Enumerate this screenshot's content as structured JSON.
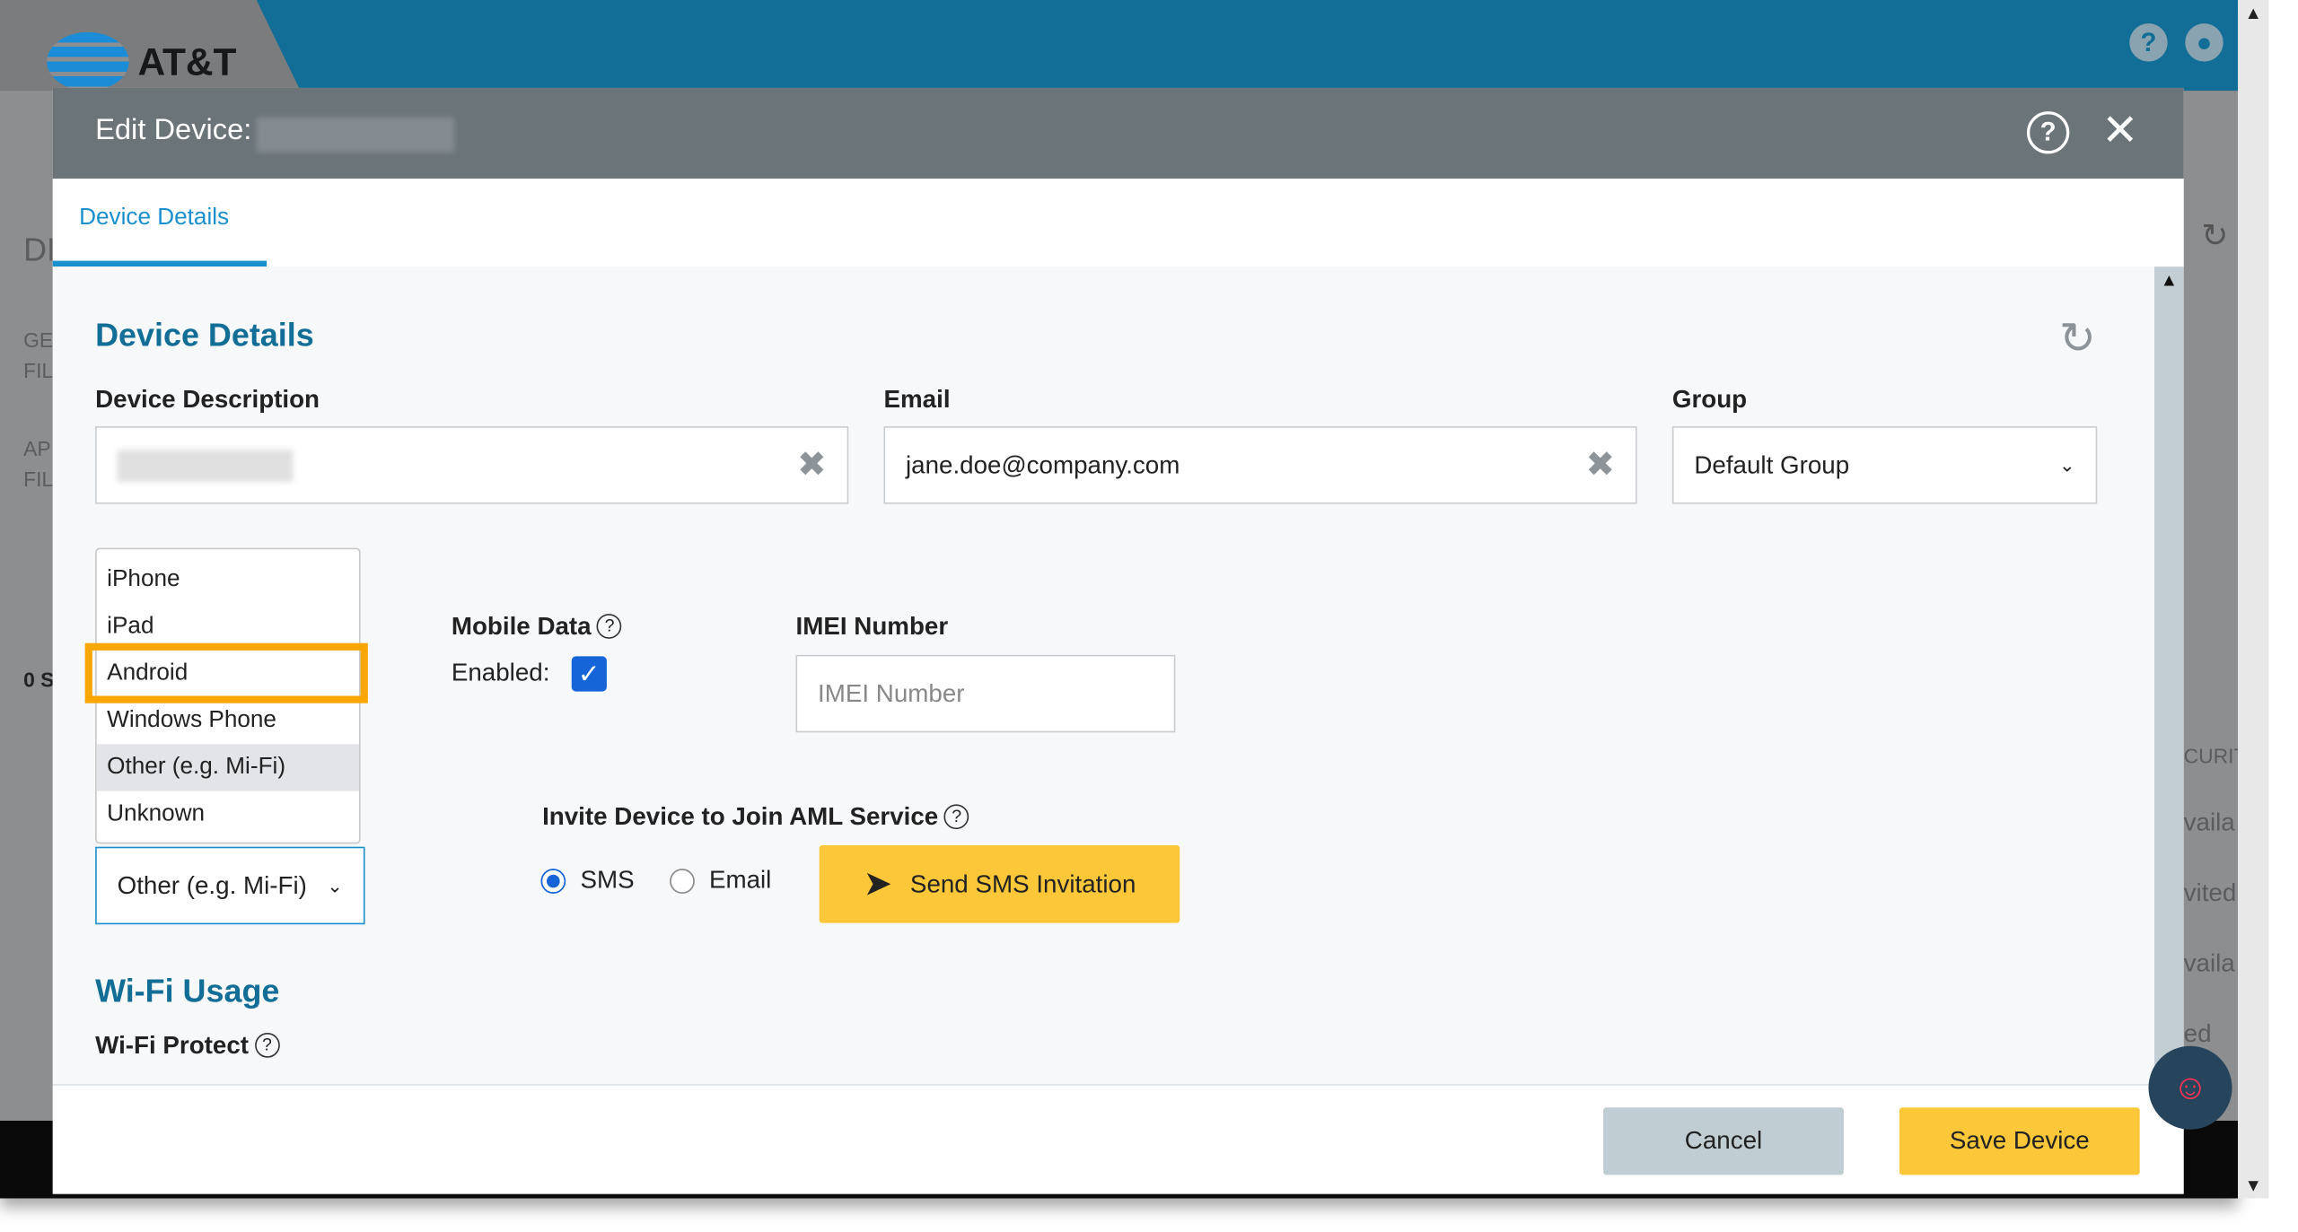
{
  "app": {
    "brand": "AT&T"
  },
  "background": {
    "partial_texts": [
      "DI",
      "GE",
      "FIL",
      "AP",
      "FIL",
      "0 S",
      "CURIT",
      "vaila",
      "vited",
      "vaila",
      "ed"
    ]
  },
  "modal": {
    "title": "Edit Device:",
    "tabs": [
      {
        "label": "Device Details",
        "active": true
      }
    ],
    "section_title": "Device Details",
    "device_description": {
      "label": "Device Description",
      "value": ""
    },
    "email": {
      "label": "Email",
      "value": "jane.doe@company.com"
    },
    "group": {
      "label": "Group",
      "value": "Default Group"
    },
    "device_type": {
      "options": [
        "iPhone",
        "iPad",
        "Android",
        "Windows Phone",
        "Other (e.g. Mi-Fi)",
        "Unknown"
      ],
      "selected": "Other (e.g. Mi-Fi)",
      "highlighted": "Android"
    },
    "mobile_data": {
      "label": "Mobile Data",
      "enabled_label": "Enabled:",
      "enabled": true
    },
    "imei": {
      "label": "IMEI Number",
      "placeholder": "IMEI Number",
      "value": ""
    },
    "invite": {
      "label": "Invite Device to Join AML Service",
      "options": [
        "SMS",
        "Email"
      ],
      "selected": "SMS",
      "button": "Send SMS Invitation"
    },
    "wifi": {
      "section_title": "Wi-Fi Usage",
      "protect_label": "Wi-Fi Protect"
    },
    "footer": {
      "cancel": "Cancel",
      "save": "Save Device"
    }
  },
  "colors": {
    "brand_blue": "#126e96",
    "accent": "#1a8fce",
    "button_yellow": "#fcc83a",
    "highlight_orange": "#f8a600",
    "header_gray": "#6b7479"
  }
}
